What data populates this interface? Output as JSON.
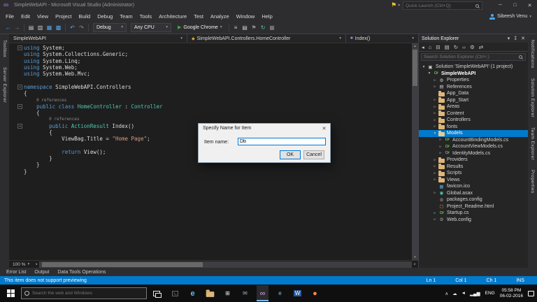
{
  "window": {
    "title": "SimpleWebAPI - Microsoft Visual Studio (Administrator)",
    "quick_launch_placeholder": "Quick Launch (Ctrl+Q)",
    "controls": [
      {
        "name": "minimize-button",
        "glyph": "─"
      },
      {
        "name": "maximize-button",
        "glyph": "□"
      },
      {
        "name": "close-button",
        "glyph": "✕"
      }
    ]
  },
  "menubar": {
    "items": [
      "File",
      "Edit",
      "View",
      "Project",
      "Build",
      "Debug",
      "Team",
      "Tools",
      "Architecture",
      "Test",
      "Analyze",
      "Window",
      "Help"
    ],
    "user": "Sibeesh Venu"
  },
  "toolbar": {
    "debug_config": "Debug",
    "platform": "Any CPU",
    "run_label": "Google Chrome",
    "groups": [
      [
        {
          "name": "navigate-back-icon",
          "glyph": "←",
          "color": "#4ea6ea"
        },
        {
          "name": "navigate-forward-icon",
          "glyph": "→",
          "color": "#8a8a8a"
        }
      ],
      [
        {
          "name": "new-project-icon",
          "glyph": "▤",
          "color": "#c8c8c8"
        },
        {
          "name": "open-file-icon",
          "glyph": "▥",
          "color": "#c8c8c8"
        },
        {
          "name": "save-icon",
          "glyph": "▦",
          "color": "#4ea6ea"
        },
        {
          "name": "save-all-icon",
          "glyph": "▩",
          "color": "#4ea6ea"
        }
      ],
      [
        {
          "name": "undo-icon",
          "glyph": "↶",
          "color": "#4ea6ea"
        },
        {
          "name": "redo-icon",
          "glyph": "↷",
          "color": "#8a8a8a"
        }
      ]
    ],
    "after_groups": [
      [
        {
          "name": "find-in-files-icon",
          "glyph": "≡",
          "color": "#c8c8c8"
        },
        {
          "name": "solution-explorer-icon",
          "glyph": "▤",
          "color": "#c8c8c8"
        },
        {
          "name": "team-explorer-icon",
          "glyph": "⚑",
          "color": "#8a8a8a"
        },
        {
          "name": "sync-icon",
          "glyph": "↻",
          "color": "#4ec9b0"
        },
        {
          "name": "extensions-icon",
          "glyph": "▦",
          "color": "#8a8a8a"
        }
      ]
    ]
  },
  "left_tabstrip": [
    "Toolbox",
    "Server Explorer"
  ],
  "right_tabstrip": [
    "Notifications",
    "Solution Explorer",
    "Team Explorer",
    "Properties"
  ],
  "editor": {
    "nav_project": "SimpleWebAPI",
    "nav_type": "SimpleWebAPI.Controllers.HomeController",
    "nav_member": "Index()",
    "zoom": "100 %",
    "lines": [
      {
        "fold": true,
        "tokens": [
          [
            "k",
            "using"
          ],
          [
            "p",
            " System;"
          ]
        ]
      },
      {
        "tokens": [
          [
            "k",
            "using"
          ],
          [
            "p",
            " System.Collections.Generic;"
          ]
        ]
      },
      {
        "tokens": [
          [
            "k",
            "using"
          ],
          [
            "p",
            " System.Linq;"
          ]
        ]
      },
      {
        "tokens": [
          [
            "k",
            "using"
          ],
          [
            "p",
            " System.Web;"
          ]
        ]
      },
      {
        "tokens": [
          [
            "k",
            "using"
          ],
          [
            "p",
            " System.Web.Mvc;"
          ]
        ]
      },
      {
        "tokens": []
      },
      {
        "fold": true,
        "tokens": [
          [
            "k",
            "namespace"
          ],
          [
            "p",
            " SimpleWebAPI.Controllers"
          ]
        ]
      },
      {
        "tokens": [
          [
            "p",
            "{"
          ]
        ]
      },
      {
        "lens": "0 references",
        "pad": "    "
      },
      {
        "fold": true,
        "tokens": [
          [
            "p",
            "    "
          ],
          [
            "k",
            "public"
          ],
          [
            "p",
            " "
          ],
          [
            "k",
            "class"
          ],
          [
            "p",
            " "
          ],
          [
            "t",
            "HomeController"
          ],
          [
            "p",
            " : "
          ],
          [
            "t",
            "Controller"
          ]
        ]
      },
      {
        "tokens": [
          [
            "p",
            "    {"
          ]
        ]
      },
      {
        "lens": "0 references",
        "pad": "        "
      },
      {
        "fold": true,
        "tokens": [
          [
            "p",
            "        "
          ],
          [
            "k",
            "public"
          ],
          [
            "p",
            " "
          ],
          [
            "t",
            "ActionResult"
          ],
          [
            "p",
            " Index()"
          ]
        ]
      },
      {
        "tokens": [
          [
            "p",
            "        {"
          ]
        ]
      },
      {
        "tokens": [
          [
            "p",
            "            ViewBag.Title = "
          ],
          [
            "s",
            "\"Home Page\""
          ],
          [
            "p",
            ";"
          ]
        ]
      },
      {
        "tokens": []
      },
      {
        "tokens": [
          [
            "p",
            "            "
          ],
          [
            "k",
            "return"
          ],
          [
            "p",
            " View();"
          ]
        ]
      },
      {
        "tokens": [
          [
            "p",
            "        }"
          ]
        ]
      },
      {
        "tokens": [
          [
            "p",
            "    }"
          ]
        ]
      },
      {
        "tokens": [
          [
            "p",
            "}"
          ]
        ]
      }
    ]
  },
  "dialog": {
    "title": "Specify Name for Item",
    "label": "Item name:",
    "value": "Db",
    "ok_label": "OK",
    "cancel_label": "Cancel"
  },
  "solution_explorer": {
    "title": "Solution Explorer",
    "search_placeholder": "Search Solution Explorer (Ctrl+;)",
    "header_icons": [
      {
        "name": "window-position-icon",
        "glyph": "▾"
      },
      {
        "name": "auto-hide-pin-icon",
        "glyph": "↧"
      },
      {
        "name": "close-icon",
        "glyph": "✕"
      }
    ],
    "toolbar_icons": [
      {
        "name": "back-icon",
        "glyph": "◂"
      },
      {
        "name": "home-icon",
        "glyph": "⌂"
      },
      {
        "name": "collapse-all-icon",
        "glyph": "⊟"
      },
      {
        "name": "show-all-files-icon",
        "glyph": "▤"
      },
      {
        "name": "refresh-icon",
        "glyph": "↻"
      },
      {
        "name": "view-code-icon",
        "glyph": "‹›"
      },
      {
        "name": "properties-icon",
        "glyph": "⚙"
      },
      {
        "name": "sync-with-active-document-icon",
        "glyph": "⇄"
      }
    ],
    "items": [
      {
        "label": "Solution 'SimpleWebAPI' (1 project)",
        "level": 0,
        "arrow": "expanded",
        "icon": "solution"
      },
      {
        "label": "SimpleWebAPI",
        "level": 1,
        "arrow": "expanded",
        "icon": "project",
        "bold": true
      },
      {
        "label": "Properties",
        "level": 2,
        "arrow": "collapsed",
        "icon": "wrench"
      },
      {
        "label": "References",
        "level": 2,
        "arrow": "collapsed",
        "icon": "references"
      },
      {
        "label": "App_Data",
        "level": 2,
        "arrow": "none",
        "icon": "folder"
      },
      {
        "label": "App_Start",
        "level": 2,
        "arrow": "collapsed",
        "icon": "folder"
      },
      {
        "label": "Areas",
        "level": 2,
        "arrow": "collapsed",
        "icon": "folder"
      },
      {
        "label": "Content",
        "level": 2,
        "arrow": "collapsed",
        "icon": "folder"
      },
      {
        "label": "Controllers",
        "level": 2,
        "arrow": "collapsed",
        "icon": "folder"
      },
      {
        "label": "fonts",
        "level": 2,
        "arrow": "collapsed",
        "icon": "folder"
      },
      {
        "label": "Models",
        "level": 2,
        "arrow": "expanded",
        "icon": "folder-open",
        "selected": true
      },
      {
        "label": "AccountBindingModels.cs",
        "level": 3,
        "arrow": "collapsed",
        "icon": "cs"
      },
      {
        "label": "AccountViewModels.cs",
        "level": 3,
        "arrow": "collapsed",
        "icon": "cs"
      },
      {
        "label": "IdentityModels.cs",
        "level": 3,
        "arrow": "collapsed",
        "icon": "cs"
      },
      {
        "label": "Providers",
        "level": 2,
        "arrow": "collapsed",
        "icon": "folder"
      },
      {
        "label": "Results",
        "level": 2,
        "arrow": "collapsed",
        "icon": "folder"
      },
      {
        "label": "Scripts",
        "level": 2,
        "arrow": "collapsed",
        "icon": "folder"
      },
      {
        "label": "Views",
        "level": 2,
        "arrow": "collapsed",
        "icon": "folder"
      },
      {
        "label": "favicon.ico",
        "level": 2,
        "arrow": "none",
        "icon": "image"
      },
      {
        "label": "Global.asax",
        "level": 2,
        "arrow": "collapsed",
        "icon": "globe"
      },
      {
        "label": "packages.config",
        "level": 2,
        "arrow": "none",
        "icon": "config"
      },
      {
        "label": "Project_Readme.html",
        "level": 2,
        "arrow": "none",
        "icon": "html"
      },
      {
        "label": "Startup.cs",
        "level": 2,
        "arrow": "collapsed",
        "icon": "cs"
      },
      {
        "label": "Web.config",
        "level": 2,
        "arrow": "collapsed",
        "icon": "config"
      }
    ]
  },
  "panel_tabs": [
    "Error List",
    "Output",
    "Data Tools Operations"
  ],
  "statusbar": {
    "message": "This item does not support previewing",
    "position": [
      "Ln 1",
      "Col 1",
      "Ch 1",
      "INS"
    ]
  },
  "taskbar": {
    "search_placeholder": "Search the web and Windows",
    "lang": "ENG",
    "time": "05:58 PM",
    "date": "06-02-2016",
    "apps": [
      {
        "name": "command-prompt-icon",
        "glyph": "›_",
        "fg": "#d8d8d8",
        "boxed": true
      },
      {
        "name": "edge-icon",
        "glyph": "e",
        "fg": "#4ec1f0",
        "big": true
      },
      {
        "name": "file-explorer-icon",
        "kind": "folder"
      },
      {
        "name": "store-icon",
        "glyph": "⊞",
        "fg": "#e8e8e8"
      },
      {
        "name": "mail-icon",
        "glyph": "✉",
        "fg": "#9ab6d8"
      },
      {
        "name": "visual-studio-icon",
        "glyph": "∞",
        "fg": "#b180d7",
        "active": true,
        "big": true
      },
      {
        "name": "ie-icon",
        "glyph": "e",
        "fg": "#7ec3ea"
      },
      {
        "name": "word-icon",
        "glyph": "W",
        "fg": "#ffffff",
        "bg": "#2b579a"
      },
      {
        "name": "firefox-icon",
        "glyph": "●",
        "fg": "#ff8a3c",
        "big": true
      }
    ],
    "tray_icons": [
      {
        "name": "tray-expand-icon",
        "glyph": "∧"
      },
      {
        "name": "onedrive-icon",
        "glyph": "☁"
      },
      {
        "name": "volume-icon",
        "glyph": "◄"
      },
      {
        "name": "network-icon",
        "glyph": "▂▄▆"
      }
    ]
  }
}
